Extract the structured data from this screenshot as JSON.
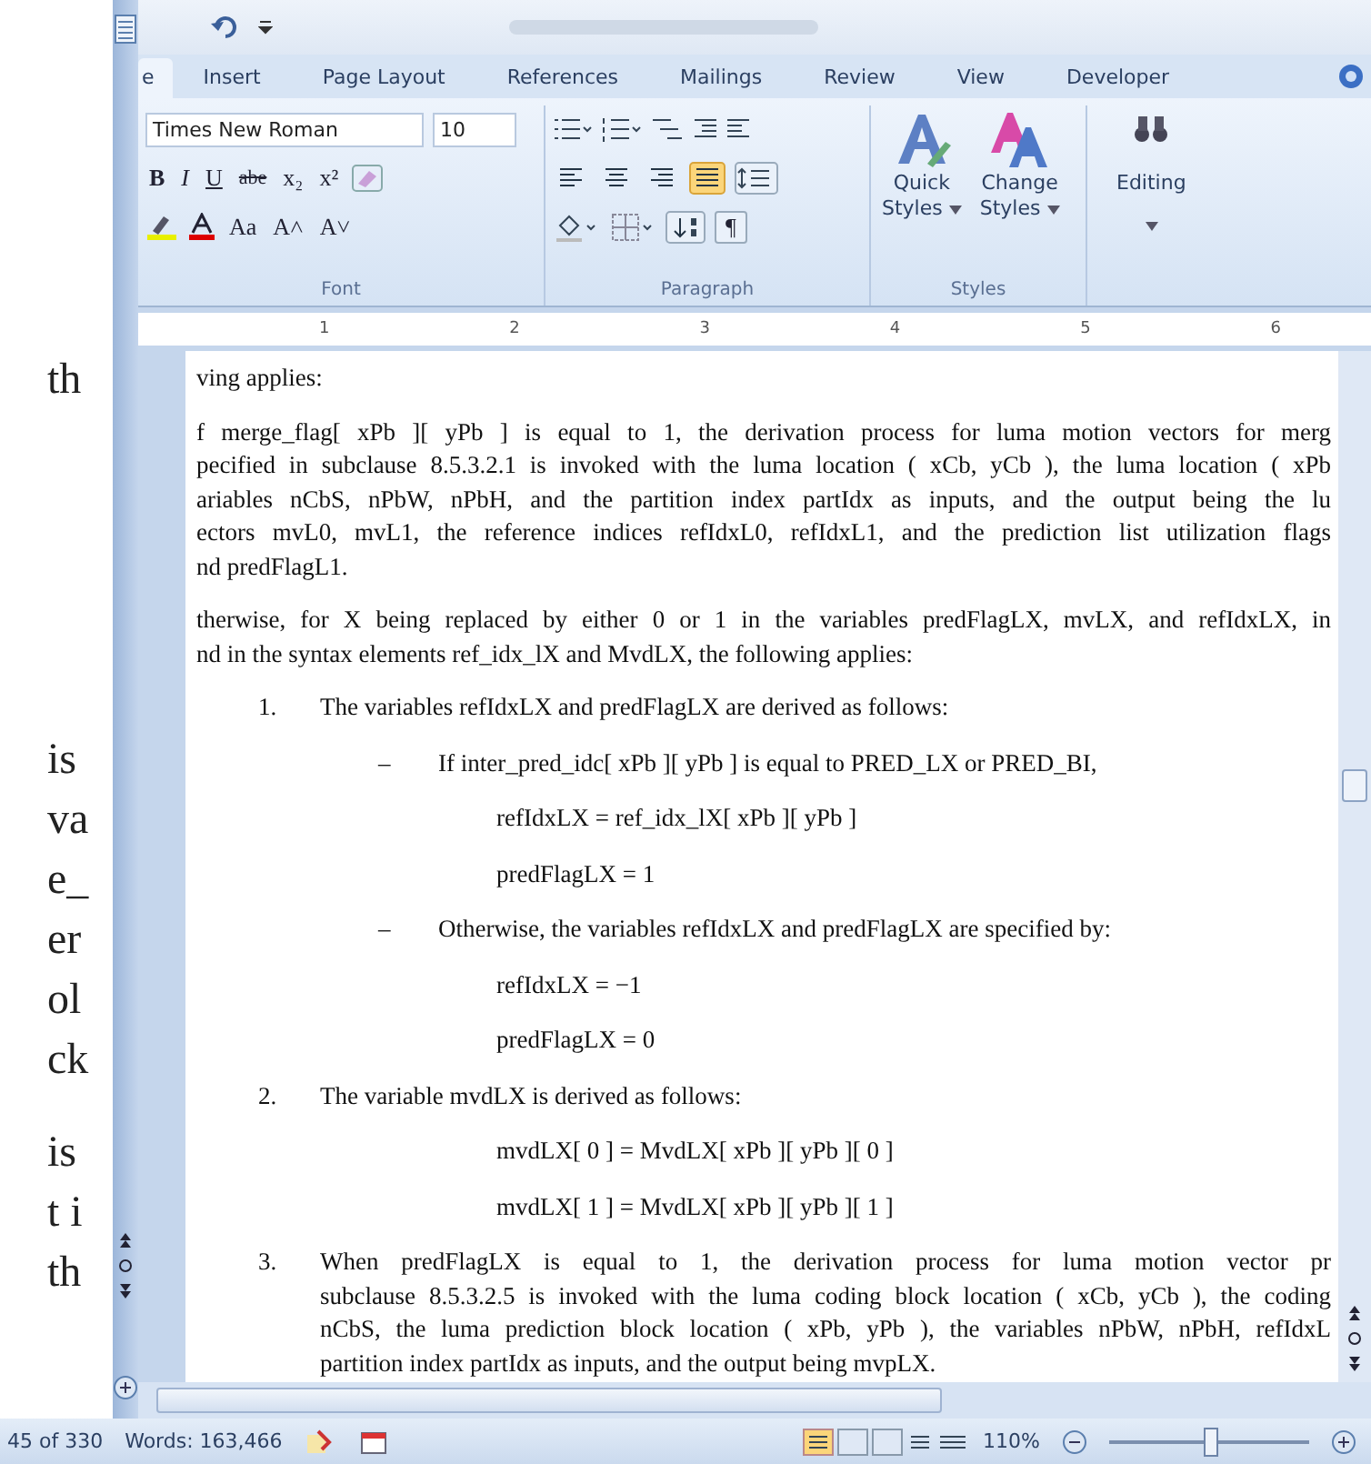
{
  "background_document": {
    "blocks": [
      [
        "th"
      ],
      [
        "is",
        "va",
        "e_",
        "er",
        "ol",
        "ck"
      ],
      [
        "is",
        "t i",
        "th"
      ]
    ]
  },
  "tabs": [
    {
      "label": "e",
      "selected": true
    },
    {
      "label": "Insert",
      "selected": false
    },
    {
      "label": "Page Layout",
      "selected": false
    },
    {
      "label": "References",
      "selected": false
    },
    {
      "label": "Mailings",
      "selected": false
    },
    {
      "label": "Review",
      "selected": false
    },
    {
      "label": "View",
      "selected": false
    },
    {
      "label": "Developer",
      "selected": false
    }
  ],
  "font_group": {
    "font_name": "Times New Roman",
    "font_size": "10",
    "label": "Font",
    "format_buttons": [
      {
        "label": "B",
        "kind": "bold"
      },
      {
        "label": "I",
        "kind": "italic"
      },
      {
        "label": "U",
        "kind": "underline"
      },
      {
        "label": "abe",
        "kind": "strike"
      },
      {
        "label": "x₂",
        "kind": "plain"
      },
      {
        "label": "x²",
        "kind": "plain"
      }
    ],
    "case_buttons": [
      "Aa",
      "A˄",
      "A˅"
    ]
  },
  "paragraph_group": {
    "label": "Paragraph",
    "alignments": [
      {
        "selected": false
      },
      {
        "selected": false
      },
      {
        "selected": false
      },
      {
        "selected": true
      }
    ],
    "pilcrow": "¶"
  },
  "styles_group": {
    "label": "Styles",
    "quick_styles": [
      "Quick",
      "Styles"
    ],
    "change_styles": [
      "Change",
      "Styles"
    ]
  },
  "editing": {
    "label": "Editing"
  },
  "ruler": {
    "numbers": [
      "1",
      "2",
      "3",
      "4",
      "5",
      "6"
    ]
  },
  "document": [
    {
      "kind": "para",
      "lines": [
        "ving applies:"
      ]
    },
    {
      "kind": "para",
      "lines": [
        "f merge_flag[ xPb ][ yPb ] is equal to 1, the derivation process for luma motion vectors for merg",
        "pecified in subclause 8.5.3.2.1 is invoked with the luma location ( xCb, yCb ), the luma location ( xPb",
        "ariables nCbS, nPbW, nPbH, and the partition index partIdx as inputs, and the output being the lu",
        "ectors mvL0, mvL1, the reference indices refIdxL0, refIdxL1, and the prediction list utilization flags",
        "nd predFlagL1."
      ]
    },
    {
      "kind": "para",
      "lines": [
        "therwise, for X being replaced by either 0 or 1 in the variables predFlagLX, mvLX, and refIdxLX, in",
        "nd in the syntax elements ref_idx_lX and MvdLX, the following applies:"
      ]
    },
    {
      "kind": "item",
      "number": "1.",
      "lines": [
        "The variables refIdxLX and predFlagLX are derived as follows:"
      ]
    },
    {
      "kind": "dash",
      "mark": "–",
      "text": "If inter_pred_idc[ xPb ][ yPb ] is equal to PRED_LX or PRED_BI,"
    },
    {
      "kind": "equation",
      "text": "refIdxLX = ref_idx_lX[ xPb ][ yPb ]"
    },
    {
      "kind": "equation",
      "text": "predFlagLX = 1"
    },
    {
      "kind": "dash",
      "mark": "–",
      "text": "Otherwise, the variables refIdxLX and predFlagLX are specified by:"
    },
    {
      "kind": "equation",
      "text": "refIdxLX = −1"
    },
    {
      "kind": "equation",
      "text": "predFlagLX = 0"
    },
    {
      "kind": "item",
      "number": "2.",
      "lines": [
        "The variable mvdLX is derived as follows:"
      ]
    },
    {
      "kind": "equation",
      "text": "mvdLX[ 0 ] = MvdLX[ xPb ][ yPb ][ 0 ]"
    },
    {
      "kind": "equation",
      "text": "mvdLX[ 1 ] = MvdLX[ xPb ][ yPb ][ 1 ]"
    },
    {
      "kind": "item",
      "number": "3.",
      "lines": [
        "When predFlagLX is equal to 1, the derivation process for luma motion vector pr",
        "subclause 8.5.3.2.5 is invoked with the luma coding block location ( xCb, yCb ), the coding",
        "nCbS, the luma prediction block location ( xPb, yPb ), the variables nPbW, nPbH, refIdxL",
        "partition index partIdx as inputs, and the output being mvpLX."
      ]
    }
  ],
  "status_bar": {
    "page": "45 of 330",
    "words": "Words: 163,466",
    "zoom": "110%",
    "zoom_slider": {
      "level": 0.5
    }
  }
}
